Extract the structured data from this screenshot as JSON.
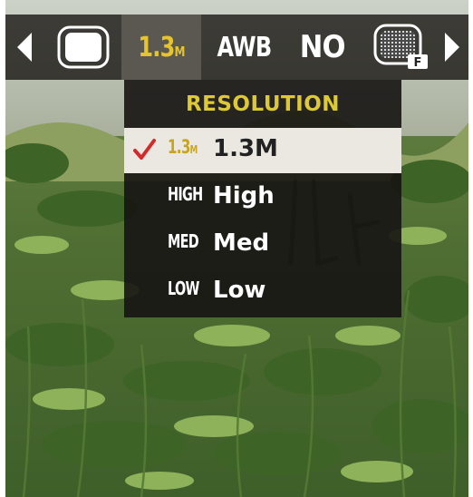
{
  "toolbar": {
    "items": [
      {
        "icon": "chevron-left-icon"
      },
      {
        "icon": "frame-icon"
      },
      {
        "main": "1.3",
        "sub": "M"
      },
      {
        "text": "AWB"
      },
      {
        "text": "NO"
      },
      {
        "icon": "screen-filter-icon",
        "sub": "F"
      },
      {
        "icon": "chevron-right-icon"
      }
    ]
  },
  "menu": {
    "title": "RESOLUTION",
    "items": [
      {
        "icon_main": "1.3",
        "icon_sub": "M",
        "label": "1.3M",
        "selected": true
      },
      {
        "icon_text": "HIGH",
        "label": "High"
      },
      {
        "icon_text": "MED",
        "label": "Med"
      },
      {
        "icon_text": "LOW",
        "label": "Low"
      }
    ]
  },
  "colors": {
    "accent_yellow": "#dcc935",
    "check_red": "#d42a2a",
    "selected_row": "#ebe8e2"
  }
}
